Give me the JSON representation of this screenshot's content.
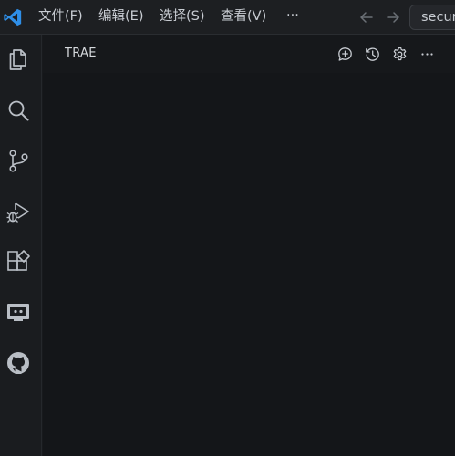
{
  "menu": {
    "file": "文件(F)",
    "edit": "编辑(E)",
    "select": "选择(S)",
    "view": "查看(V)",
    "more": "···"
  },
  "search": {
    "value": "secur"
  },
  "panel": {
    "title": "TRAE"
  },
  "colors": {
    "accent": "#2f8fe8",
    "icon": "#b9bec5",
    "background": "#141619"
  },
  "icons": {
    "logo": "vscode-logo",
    "explorer": "files-icon",
    "search": "search-icon",
    "source_control": "source-control-icon",
    "run_debug": "run-debug-icon",
    "extensions": "extensions-icon",
    "remote": "remote-explorer-icon",
    "github": "github-icon",
    "new_chat": "new-chat-icon",
    "history": "history-icon",
    "settings": "gear-icon",
    "more": "more-icon"
  }
}
